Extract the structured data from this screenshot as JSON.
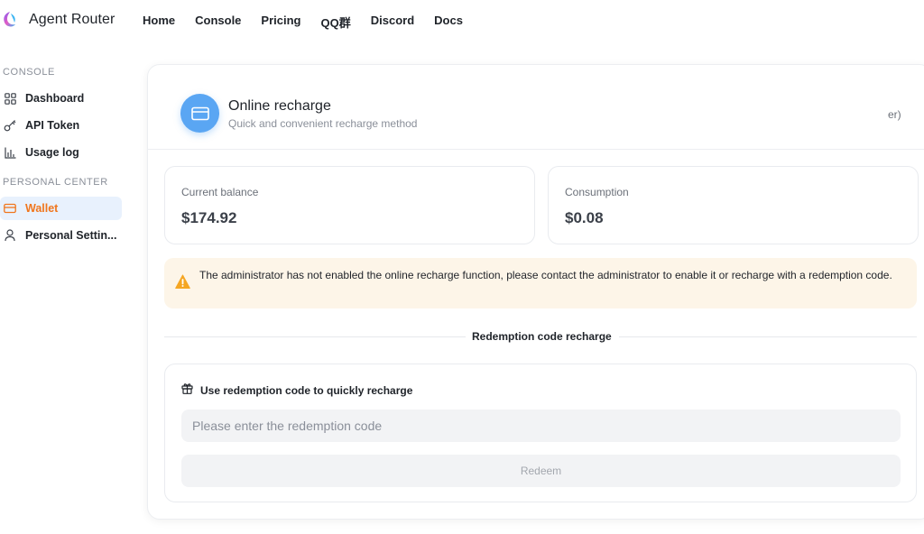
{
  "brand": {
    "name": "Agent Router",
    "logo_icon": "agent-router-logo-icon"
  },
  "nav": [
    {
      "label": "Home"
    },
    {
      "label": "Console"
    },
    {
      "label": "Pricing"
    },
    {
      "label": "QQ群"
    },
    {
      "label": "Discord"
    },
    {
      "label": "Docs"
    }
  ],
  "sidebar": {
    "console_title": "CONSOLE",
    "personal_title": "PERSONAL CENTER",
    "items": [
      {
        "label": "Dashboard",
        "icon": "dashboard-grid-icon"
      },
      {
        "label": "API Token",
        "icon": "key-icon"
      },
      {
        "label": "Usage log",
        "icon": "bar-chart-icon"
      },
      {
        "label": "Wallet",
        "icon": "wallet-icon",
        "active": true
      },
      {
        "label": "Personal Settin...",
        "icon": "user-icon"
      }
    ]
  },
  "header": {
    "title": "Online recharge",
    "subtitle": "Quick and convenient recharge method",
    "right_text": "er)",
    "icon": "credit-card-icon"
  },
  "stats": {
    "balance": {
      "label": "Current balance",
      "value": "$174.92"
    },
    "consumption": {
      "label": "Consumption",
      "value": "$0.08"
    }
  },
  "alert": {
    "text": "The administrator has not enabled the online recharge function, please contact the administrator to enable it or recharge with a redemption code.",
    "icon": "warning-icon",
    "color": "#f5a623"
  },
  "redemption": {
    "divider_label": "Redemption code recharge",
    "title": "Use redemption code to quickly recharge",
    "title_icon": "gift-icon",
    "input_placeholder": "Please enter the redemption code",
    "input_value": "",
    "button_label": "Redeem"
  },
  "colors": {
    "accent_blue": "#5aa6f3",
    "active_orange": "#f0761d",
    "active_bg": "#e8f1fd",
    "alert_bg": "#fdf5e8"
  }
}
